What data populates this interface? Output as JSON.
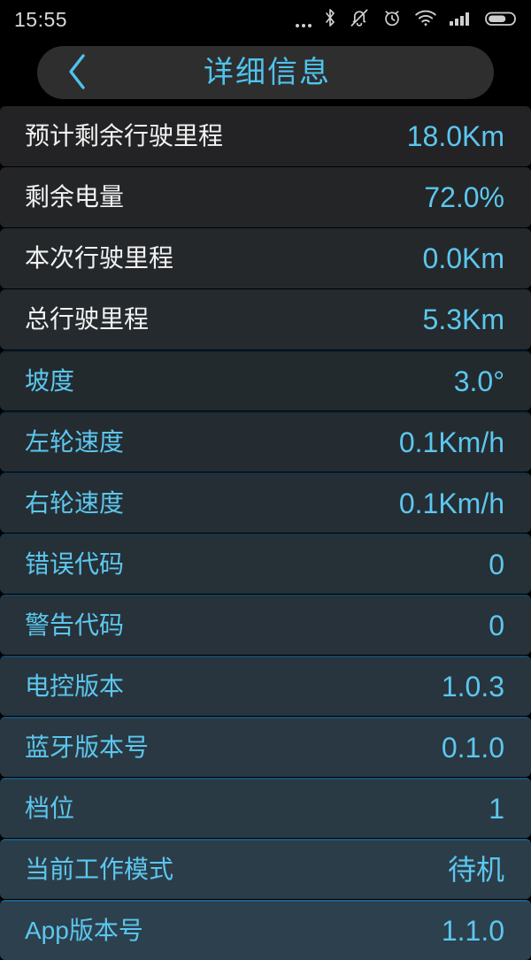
{
  "status_bar": {
    "time": "15:55",
    "icons": [
      {
        "name": "more-dots-icon",
        "glyph": "dots"
      },
      {
        "name": "bluetooth-icon",
        "glyph": "bluetooth"
      },
      {
        "name": "silent-mode-icon",
        "glyph": "bell-muted"
      },
      {
        "name": "alarm-clock-icon",
        "glyph": "alarm"
      },
      {
        "name": "wifi-icon",
        "glyph": "wifi"
      },
      {
        "name": "cellular-signal-icon",
        "glyph": "signal"
      },
      {
        "name": "battery-icon",
        "glyph": "battery"
      }
    ]
  },
  "title_bar": {
    "title": "详细信息",
    "back_label": "‹"
  },
  "colors": {
    "accent_cyan": "#5cc7ee",
    "label_white": "#f2f2f2",
    "background": "#000000",
    "title_pill": "#2e2e2e"
  },
  "rows": [
    {
      "label": "预计剩余行驶里程",
      "value": "18.0Km",
      "label_style": "white"
    },
    {
      "label": "剩余电量",
      "value": "72.0%",
      "label_style": "white"
    },
    {
      "label": "本次行驶里程",
      "value": "0.0Km",
      "label_style": "white"
    },
    {
      "label": "总行驶里程",
      "value": "5.3Km",
      "label_style": "white"
    },
    {
      "label": "坡度",
      "value": "3.0°",
      "label_style": "cyan"
    },
    {
      "label": "左轮速度",
      "value": "0.1Km/h",
      "label_style": "cyan"
    },
    {
      "label": "右轮速度",
      "value": "0.1Km/h",
      "label_style": "cyan"
    },
    {
      "label": "错误代码",
      "value": "0",
      "label_style": "cyan"
    },
    {
      "label": "警告代码",
      "value": "0",
      "label_style": "cyan"
    },
    {
      "label": "电控版本",
      "value": "1.0.3",
      "label_style": "cyan"
    },
    {
      "label": "蓝牙版本号",
      "value": "0.1.0",
      "label_style": "cyan"
    },
    {
      "label": "档位",
      "value": "1",
      "label_style": "cyan"
    },
    {
      "label": "当前工作模式",
      "value": "待机",
      "label_style": "cyan"
    },
    {
      "label": "App版本号",
      "value": "1.1.0",
      "label_style": "cyan"
    }
  ]
}
